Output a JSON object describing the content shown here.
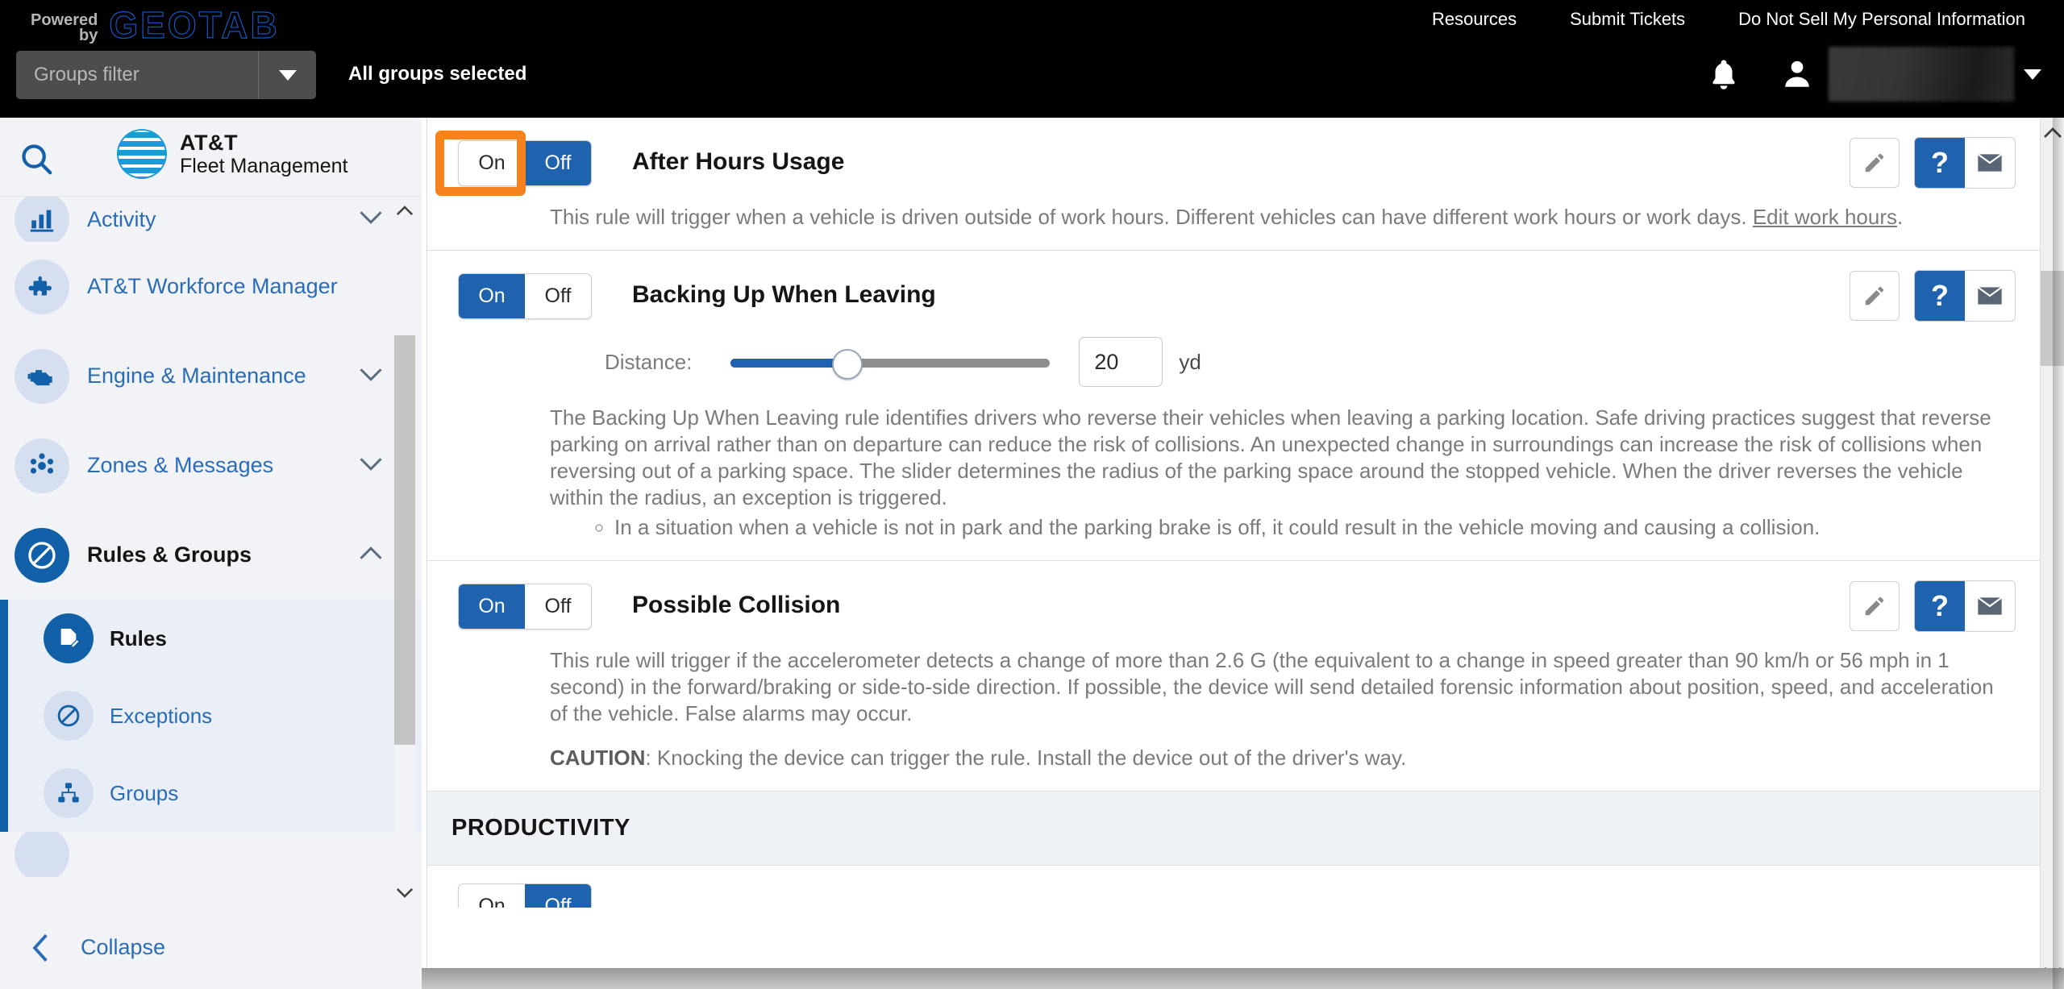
{
  "header": {
    "powered_by_line1": "Powered",
    "powered_by_line2": "by",
    "brand": "GEOTAB",
    "links": [
      "Resources",
      "Submit Tickets",
      "Do Not Sell My Personal Information"
    ],
    "groups_filter_placeholder": "Groups filter",
    "groups_status": "All groups selected",
    "bell_icon": "bell-icon",
    "profile_icon": "person-icon",
    "user_caret_icon": "caret-down-icon"
  },
  "sidebar": {
    "search_icon": "search-icon",
    "logo_line1": "AT&T",
    "logo_line2": "Fleet Management",
    "items": [
      {
        "label": "Activity",
        "icon": "bar-chart-icon",
        "chevron": "chevron-down-icon",
        "clipped": true
      },
      {
        "label": "AT&T Workforce Manager",
        "icon": "puzzle-piece-icon",
        "chevron": ""
      },
      {
        "label": "Engine & Maintenance",
        "icon": "engine-icon",
        "chevron": "chevron-down-icon"
      },
      {
        "label": "Zones & Messages",
        "icon": "zones-icon",
        "chevron": "chevron-down-icon"
      },
      {
        "label": "Rules & Groups",
        "icon": "rules-icon",
        "chevron": "chevron-up-icon",
        "active": true
      }
    ],
    "subitems": [
      {
        "label": "Rules",
        "icon": "rules-document-icon",
        "selected": true
      },
      {
        "label": "Exceptions",
        "icon": "exceptions-icon",
        "selected": false
      },
      {
        "label": "Groups",
        "icon": "groups-hierarchy-icon",
        "selected": false
      }
    ],
    "collapse_label": "Collapse",
    "collapse_icon": "chevron-left-icon"
  },
  "main": {
    "rules": [
      {
        "title": "After Hours Usage",
        "toggle": {
          "on_label": "On",
          "off_label": "Off",
          "state": "Off",
          "highlighted": "On"
        },
        "description_pre": "This rule will trigger when a vehicle is driven outside of work hours. Different vehicles can have different work hours or work days. ",
        "description_link": "Edit work hours",
        "description_post": ".",
        "actions": [
          "edit-pencil-icon",
          "help-question-icon",
          "email-envelope-icon"
        ]
      },
      {
        "title": "Backing Up When Leaving",
        "toggle": {
          "on_label": "On",
          "off_label": "Off",
          "state": "On"
        },
        "distance_label": "Distance:",
        "distance_value": "20",
        "distance_unit": "yd",
        "slider_percent": 33,
        "description": "The Backing Up When Leaving rule identifies drivers who reverse their vehicles when leaving a parking location. Safe driving practices suggest that reverse parking on arrival rather than on departure can reduce the risk of collisions. An unexpected change in surroundings can increase the risk of collisions when reversing out of a parking space. The slider determines the radius of the parking space around the stopped vehicle. When the driver reverses the vehicle within the radius, an exception is triggered.",
        "bullets": [
          "In a situation when a vehicle is not in park and the parking brake is off, it could result in the vehicle moving and causing a collision."
        ],
        "actions": [
          "edit-pencil-icon",
          "help-question-icon",
          "email-envelope-icon"
        ]
      },
      {
        "title": "Possible Collision",
        "toggle": {
          "on_label": "On",
          "off_label": "Off",
          "state": "On"
        },
        "description": "This rule will trigger if the accelerometer detects a change of more than 2.6 G (the equivalent to a change in speed greater than 90 km/h or 56 mph in 1 second) in the forward/braking or side-to-side direction. If possible, the device will send detailed forensic information about position, speed, and acceleration of the vehicle. False alarms may occur.",
        "caution_label": "CAUTION",
        "caution_text": ": Knocking the device can trigger the rule. Install the device out of the driver's way.",
        "actions": [
          "edit-pencil-icon",
          "help-question-icon",
          "email-envelope-icon"
        ]
      }
    ],
    "section_header": "PRODUCTIVITY",
    "partial_rule": {
      "on_label": "On",
      "off_label": "Off",
      "state": "Off"
    }
  },
  "colors": {
    "accent_blue": "#1f62ae",
    "highlight_orange": "#f5821f",
    "sidebar_bg": "#f1f3f6",
    "topbar_bg": "#000000",
    "att_blue": "#1a9bd7"
  }
}
